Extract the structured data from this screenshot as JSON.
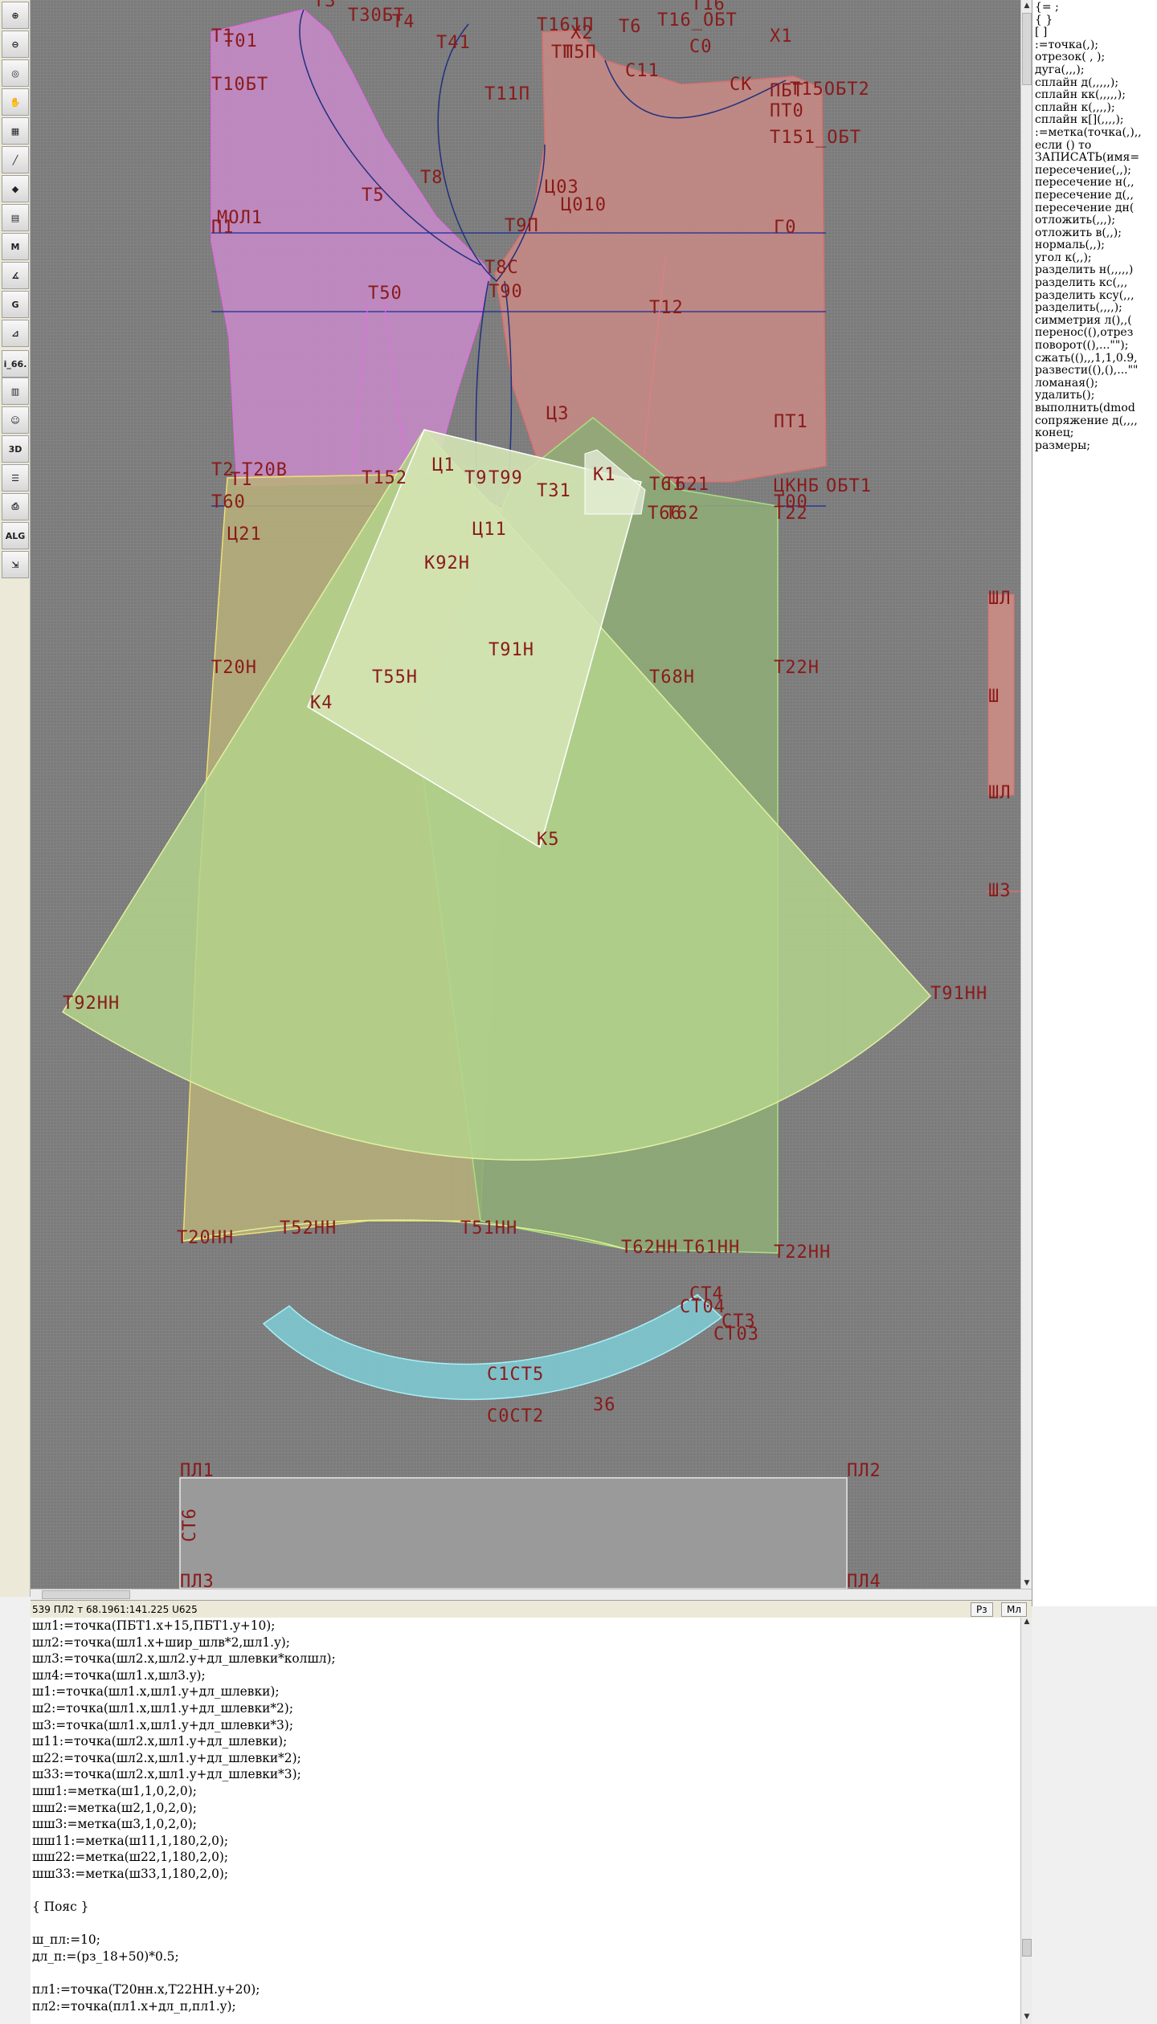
{
  "toolbar": {
    "buttons": [
      {
        "icon": "zoom-in-icon",
        "glyph": "⊕"
      },
      {
        "icon": "zoom-out-icon",
        "glyph": "⊖"
      },
      {
        "icon": "zoom-fit-icon",
        "glyph": "◎"
      },
      {
        "icon": "pan-icon",
        "glyph": "✋"
      },
      {
        "icon": "grid-icon",
        "glyph": "▦"
      },
      {
        "icon": "segment-icon",
        "glyph": "╱"
      },
      {
        "icon": "layers-icon",
        "glyph": "◆"
      },
      {
        "icon": "page-icon",
        "glyph": "▤"
      },
      {
        "icon": "marker-icon",
        "glyph": "M"
      },
      {
        "icon": "angle-icon",
        "glyph": "∡"
      },
      {
        "icon": "grading-icon",
        "glyph": "G"
      },
      {
        "icon": "measure-icon",
        "glyph": "⊿"
      },
      {
        "icon": "file-label",
        "glyph": "i_66."
      },
      {
        "icon": "notes-icon",
        "glyph": "▥"
      },
      {
        "icon": "figure-icon",
        "glyph": "☺"
      },
      {
        "icon": "view-3d-icon",
        "glyph": "3D"
      },
      {
        "icon": "list-icon",
        "glyph": "☰"
      },
      {
        "icon": "print-icon",
        "glyph": "⎙"
      },
      {
        "icon": "algorithm-icon",
        "glyph": "ALG"
      },
      {
        "icon": "export-icon",
        "glyph": "⇲"
      }
    ]
  },
  "canvas": {
    "labels": {
      "t1": "T1",
      "t01": "T01",
      "t3": "T3",
      "t30bt": "T30БТ",
      "t4": "T4",
      "t41": "T41",
      "t161p": "T161П",
      "t16": "T16",
      "t16_obt": "T16_ОБТ",
      "t6": "T6",
      "x2": "X2",
      "x1": "X1",
      "tp": "TП",
      "t5p": "T5П",
      "t11p": "T11П",
      "c11": "C11",
      "c0": "C0",
      "ck": "CK",
      "t10bt": "T10БТ",
      "pbt": "ПБТ",
      "t15obt2": "T15ОБТ2",
      "pt0": "ПТ0",
      "t151_obt": "T151_ОБТ",
      "t8": "T8",
      "t5": "T5",
      "t03": "Ц03",
      "t010": "Ц010",
      "mol1": "МОЛ1",
      "p1": "П1",
      "t9p": "T9П",
      "t90": "T90",
      "r0": "Г0",
      "t8c": "T8C",
      "t50": "T50",
      "t12": "T12",
      "ts3": "Ц3",
      "pt1": "ПТ1",
      "t20v": "T20В",
      "t2": "T2",
      "t1s2": "T1",
      "t152": "T152",
      "ts1": "Ц1",
      "t9": "T9",
      "t99": "T99",
      "t31": "T31",
      "k1": "K1",
      "t61": "T61",
      "t621": "T621",
      "ckhb": "ЦКНБ",
      "obt1": "ОБТ1",
      "t00": "Т00",
      "t22": "T22",
      "t60": "T60",
      "t66": "T66",
      "t62": "T62",
      "ts21": "Ц21",
      "ts11": "Ц11",
      "k92h": "K92H",
      "t91h": "T91H",
      "t20h": "T20H",
      "t55h": "T55H",
      "t68h": "T68H",
      "t22h": "T22H",
      "k4": "K4",
      "k5": "K5",
      "t92hh": "T92HH",
      "t91hh": "T91HH",
      "t20hh": "T20HH",
      "t52hh": "T52HH",
      "t51hh": "T51HH",
      "t62hh": "T62HH",
      "t61hh": "T61HH",
      "t22hh": "T22HH",
      "ct4": "CT4",
      "ct04": "CT04",
      "ct3": "CT3",
      "ct03": "CT03",
      "ct5": "C1CT5",
      "ct2": "C0CT2",
      "n36": "36",
      "pl1": "ПЛ1",
      "pl2": "ПЛ2",
      "pl3": "ПЛ3",
      "pl4": "ПЛ4",
      "st6": "СТ6",
      "sh1": "ШЛ",
      "sh2": "Ш",
      "sh3": "ШЛ",
      "sh4": "ШЗ"
    }
  },
  "right_panel": {
    "commands": [
      "{= ;",
      "  { }",
      "  [  ]",
      ":=точка(,);",
      "отрезок( , );",
      "дуга(,,,);",
      "сплайн  д(,,,,,);",
      "сплайн  кк(,,,,,);",
      "сплайн  к(,,,,);",
      "сплайн  к[](,,,,);",
      ":=метка(точка(,),,",
      "если () то",
      "ЗАПИСАТЬ(имя=",
      "пересечение(,,);",
      "пересечение  н(,,",
      "пересечение  д(,,",
      "пересечение  дн(",
      "отложить(,,,);",
      "отложить  в(,,);",
      "нормаль(,,);",
      "угол  к(,,);",
      "разделить  н(,,,,,)",
      "разделить  кс(,,,",
      "разделить  ксу(,,,",
      "разделить(,,,,);",
      "симметрия  л(),,(",
      "перенос((),отрез",
      "поворот((),...\"\");",
      "сжать((),,,1,1,0.9,",
      "развести((),(),...\"\"",
      "ломаная();",
      "удалить();",
      "выполнить(dmod",
      "сопряжение  д(,,,,",
      "конец;",
      "размеры;"
    ]
  },
  "statusbar": {
    "text": "539  ПЛ2 т 68.1961:141.225  U625",
    "btn_rz": "Рз",
    "btn_ml": "Мл"
  },
  "editor": {
    "lines": [
      "шл1:=точка(ПБТ1.x+15,ПБТ1.y+10);",
      "шл2:=точка(шл1.x+шир_шлв*2,шл1.y);",
      "шл3:=точка(шл2.x,шл2.y+дл_шлевки*колшл);",
      "шл4:=точка(шл1.x,шл3.y);",
      "ш1:=точка(шл1.x,шл1.y+дл_шлевки);",
      "ш2:=точка(шл1.x,шл1.y+дл_шлевки*2);",
      "ш3:=точка(шл1.x,шл1.y+дл_шлевки*3);",
      "ш11:=точка(шл2.x,шл1.y+дл_шлевки);",
      "ш22:=точка(шл2.x,шл1.y+дл_шлевки*2);",
      "ш33:=точка(шл2.x,шл1.y+дл_шлевки*3);",
      "шш1:=метка(ш1,1,0,2,0);",
      "шш2:=метка(ш2,1,0,2,0);",
      "шш3:=метка(ш3,1,0,2,0);",
      "шш11:=метка(ш11,1,180,2,0);",
      "шш22:=метка(ш22,1,180,2,0);",
      "шш33:=метка(ш33,1,180,2,0);",
      "",
      "{ Пояс }",
      "",
      "ш_пл:=10;",
      "дл_п:=(рз_18+50)*0.5;",
      "",
      "пл1:=точка(Т20нн.x,Т22НН.y+20);",
      "пл2:=точка(пл1.x+дл_п,пл1.y);"
    ]
  }
}
